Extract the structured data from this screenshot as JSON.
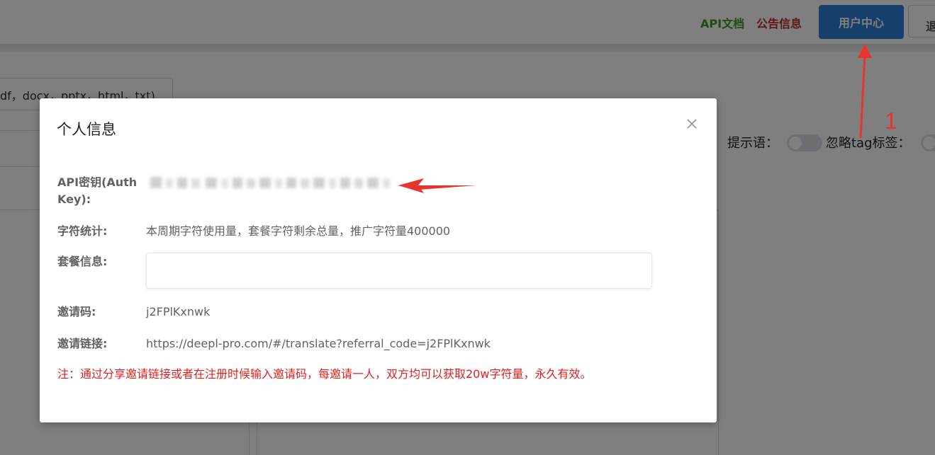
{
  "header": {
    "api_docs": "API文档",
    "notice": "公告信息",
    "user_center": "用户中心",
    "logout": "退",
    "colors": {
      "api_docs": "#3f9a23",
      "notice": "#c62d2d",
      "user_center_bg": "#2f7fd6"
    }
  },
  "background": {
    "upload_formats": "df，docx，pptx，html，txt)",
    "option_hint_label": "提示语：",
    "option_ignore_tag_label": "忽略tag标签："
  },
  "annotation": {
    "number": "1",
    "color": "#e8342f"
  },
  "modal": {
    "title": "个人信息",
    "api_key_label": "API密钥(Auth Key):",
    "stats_label": "字符统计:",
    "stats_value": "本周期字符使用量，套餐字符剩余总量，推广字符量400000",
    "plan_label": "套餐信息:",
    "invite_code_label": "邀请码:",
    "invite_code_value": "j2FPlKxnwk",
    "invite_link_label": "邀请链接:",
    "invite_link_value": "https://deepl-pro.com/#/translate?referral_code=j2FPlKxnwk",
    "note": "注：通过分享邀请链接或者在注册时候输入邀请码，每邀请一人，双方均可以获取20w字符量，永久有效。",
    "note_color": "#e02020"
  }
}
